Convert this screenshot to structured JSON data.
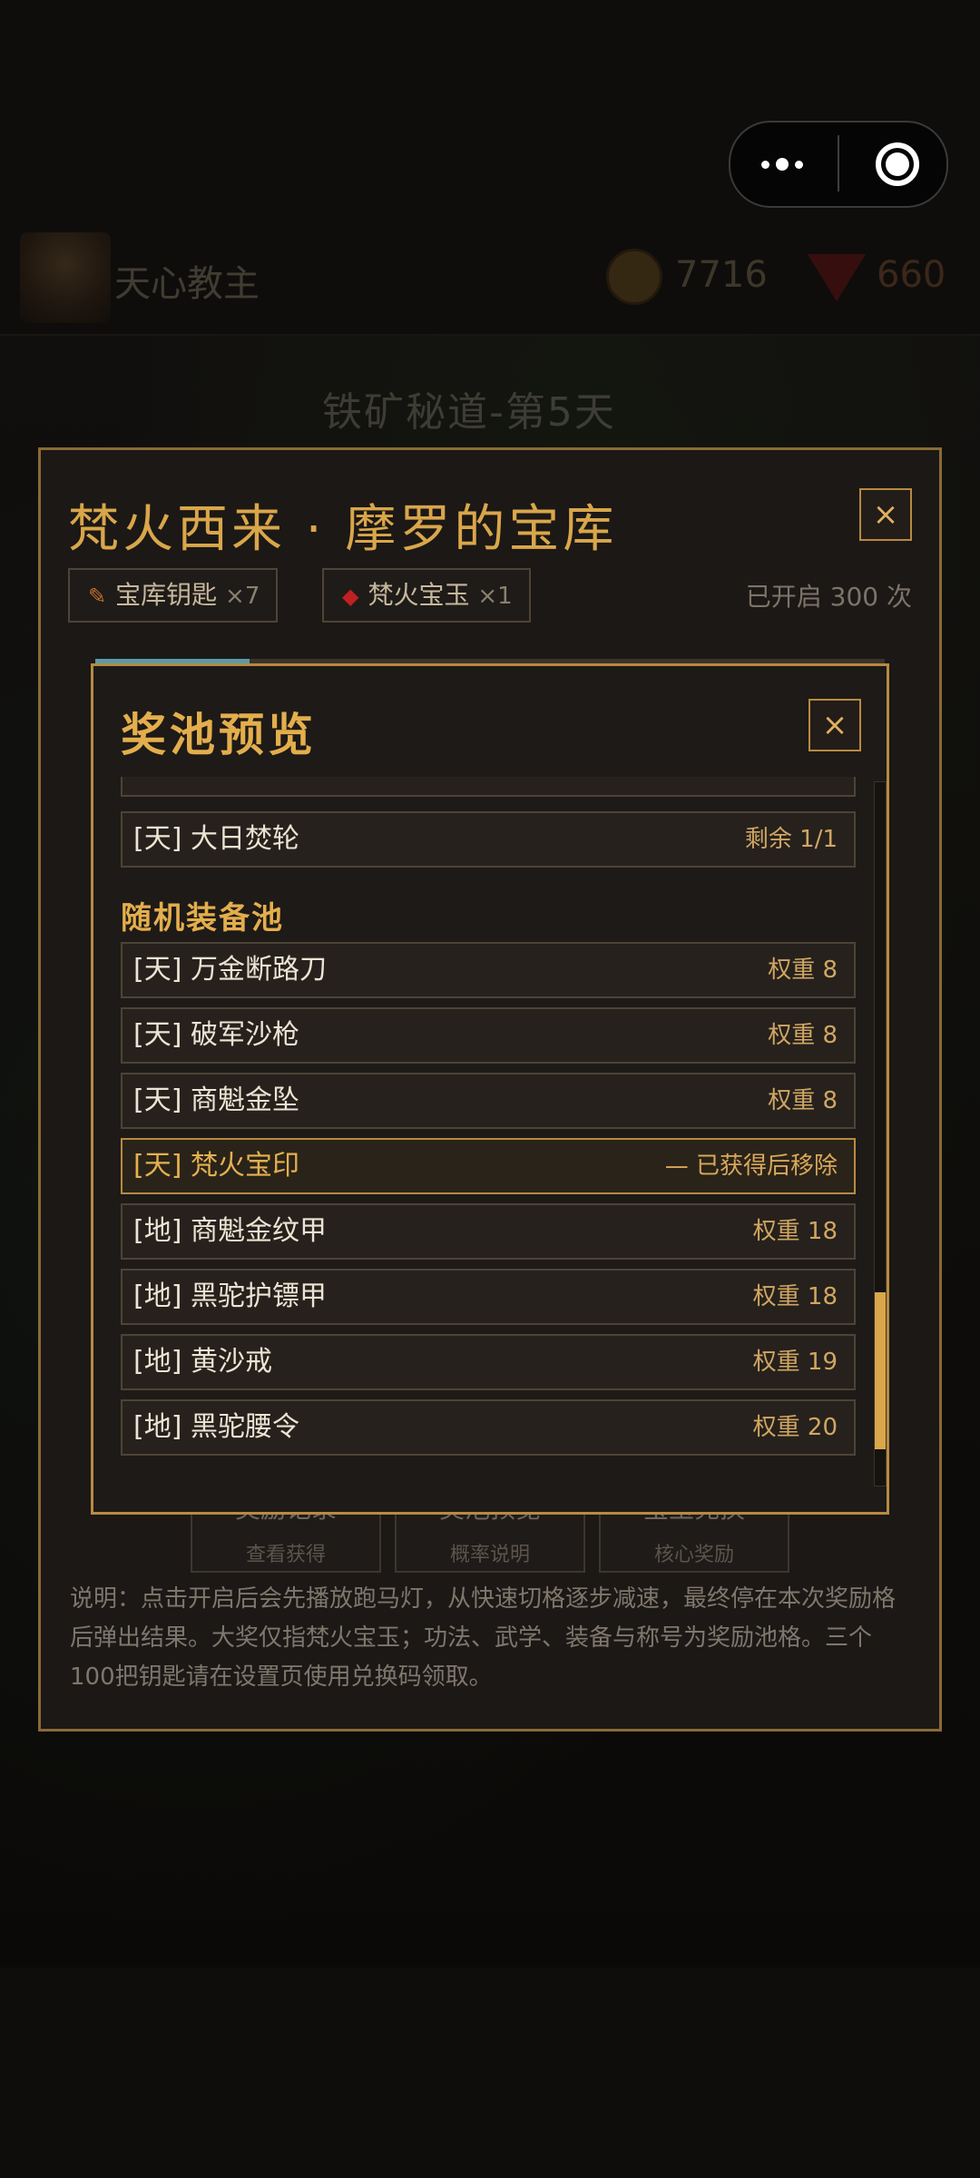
{
  "capsule": {
    "menu_icon": "more-dots-icon",
    "close_icon": "target-close-icon"
  },
  "header": {
    "player_name": "天心教主",
    "coins": "7716",
    "gems": "660",
    "stage_title": "铁矿秘道-第5天"
  },
  "outer_modal": {
    "title": "梵火西来 · 摩罗的宝库",
    "close_label": "×",
    "keys_chip": {
      "label": "宝库钥匙",
      "count": "×7",
      "icon": "key-icon"
    },
    "jade_chip": {
      "label": "梵火宝玉",
      "count": "×1",
      "icon": "gem-icon"
    },
    "opened_text": "已开启 300 次",
    "tabs": [
      {
        "label": "奖励记录",
        "sub": "查看获得"
      },
      {
        "label": "奖池预览",
        "sub": "概率说明"
      },
      {
        "label": "宝玉兑换",
        "sub": "核心奖励"
      }
    ],
    "description": "说明：点击开启后会先播放跑马灯，从快速切格逐步减速，最终停在本次奖励格后弹出结果。大奖仅指梵火宝玉；功法、武学、装备与称号为奖励池格。三个100把钥匙请在设置页使用兑换码领取。"
  },
  "inner_modal": {
    "title": "奖池预览",
    "close_label": "×",
    "top_items": [
      {
        "name": "[天] 大日焚轮",
        "value": "剩余 1/1"
      }
    ],
    "section_title": "随机装备池",
    "items": [
      {
        "name": "[天] 万金断路刀",
        "value": "权重 8"
      },
      {
        "name": "[天] 破军沙枪",
        "value": "权重 8"
      },
      {
        "name": "[天] 商魁金坠",
        "value": "权重 8"
      },
      {
        "name": "[天] 梵火宝印",
        "value": "— 已获得后移除",
        "highlight": true
      },
      {
        "name": "[地] 商魁金纹甲",
        "value": "权重 18"
      },
      {
        "name": "[地] 黑驼护镖甲",
        "value": "权重 18"
      },
      {
        "name": "[地] 黄沙戒",
        "value": "权重 19"
      },
      {
        "name": "[地] 黑驼腰令",
        "value": "权重 20"
      }
    ]
  },
  "colors": {
    "accent_gold": "#e3ae4c",
    "border_gold": "#b88a40",
    "panel": "#1e1a17"
  }
}
